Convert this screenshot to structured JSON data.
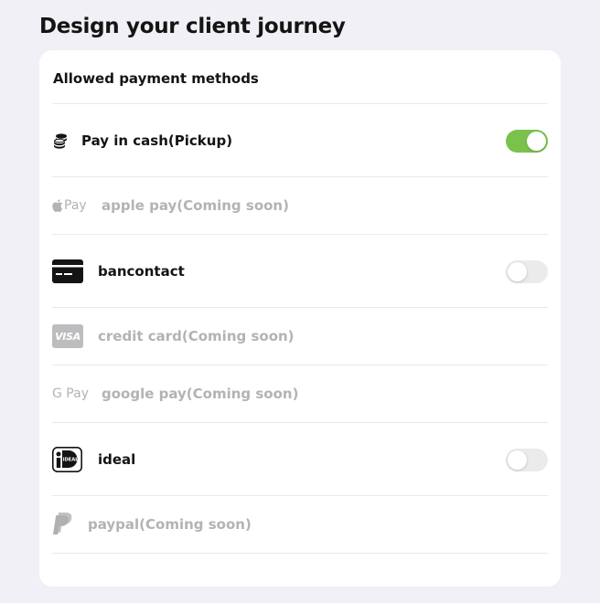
{
  "page": {
    "title": "Design your client journey"
  },
  "card": {
    "section_title": "Allowed payment methods",
    "methods": [
      {
        "label": "Pay in cash(Pickup)",
        "icon": "coins-icon",
        "enabled": true,
        "toggle_on": true
      },
      {
        "label": "apple pay(Coming soon)",
        "icon": "apple-pay-icon",
        "icon_text": "Pay",
        "enabled": false
      },
      {
        "label": "bancontact",
        "icon": "bancontact-card-icon",
        "enabled": true,
        "toggle_on": false
      },
      {
        "label": "credit card(Coming soon)",
        "icon": "visa-icon",
        "icon_text": "VISA",
        "enabled": false
      },
      {
        "label": "google pay(Coming soon)",
        "icon": "google-pay-icon",
        "icon_text": "G Pay",
        "enabled": false
      },
      {
        "label": "ideal",
        "icon": "ideal-icon",
        "icon_text": "iDEAL",
        "enabled": true,
        "toggle_on": false
      },
      {
        "label": "paypal(Coming soon)",
        "icon": "paypal-icon",
        "enabled": false
      }
    ]
  },
  "colors": {
    "toggle_on": "#7bc24d",
    "toggle_off": "#ebebec",
    "disabled_text": "#b3b3b6"
  }
}
